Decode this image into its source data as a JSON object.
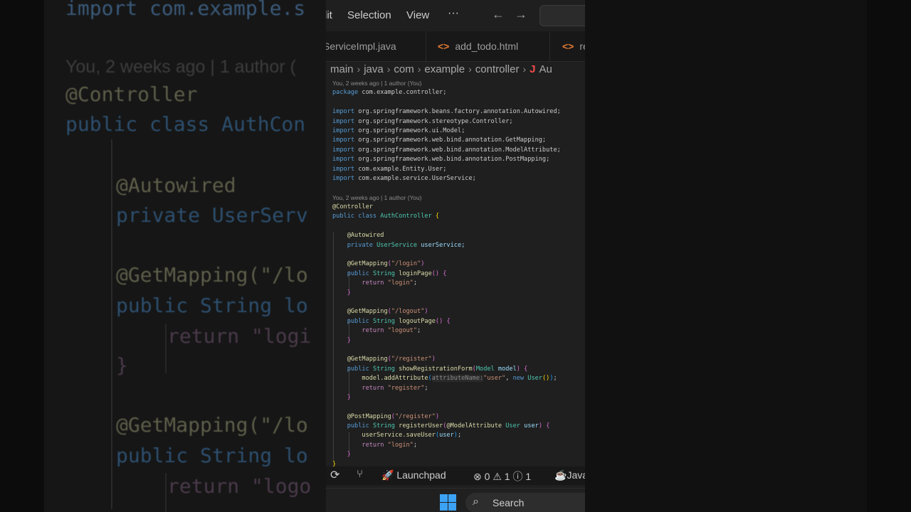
{
  "menubar": {
    "items": [
      "lit",
      "Selection",
      "View",
      "···"
    ]
  },
  "tabs": [
    {
      "label": "ServiceImpl.java",
      "icon": "java-file-icon"
    },
    {
      "label": "add_todo.html",
      "icon": "html-file-icon",
      "glyph": "<>"
    },
    {
      "label": "re",
      "icon": "html-file-icon",
      "glyph": "<>"
    }
  ],
  "breadcrumb": {
    "parts": [
      "main",
      "java",
      "com",
      "example",
      "controller"
    ],
    "file_glyph": "J",
    "file": "Au",
    "separator": "›"
  },
  "codelens": {
    "top": "You, 2 weeks ago | 1 author (You)",
    "class": "You, 2 weeks ago | 1 author (You)"
  },
  "code": {
    "package_kw": "package",
    "package_name": "com.example.controller;",
    "import_kw": "import",
    "imports": [
      "org.springframework.beans.factory.annotation.Autowired;",
      "org.springframework.stereotype.Controller;",
      "org.springframework.ui.Model;",
      "org.springframework.web.bind.annotation.GetMapping;",
      "org.springframework.web.bind.annotation.ModelAttribute;",
      "org.springframework.web.bind.annotation.PostMapping;",
      "com.example.Entity.User;",
      "com.example.service.UserService;"
    ],
    "class_annotation": "@Controller",
    "public_kw": "public",
    "class_kw": "class",
    "class_name": "AuthController",
    "open_brace": "{",
    "close_brace": "}",
    "field_annotation": "@Autowired",
    "private_kw": "private",
    "field_type": "UserService",
    "field_name": "userService;",
    "get_mapping": "@GetMapping",
    "post_mapping": "@PostMapping",
    "string_type": "String",
    "return_kw": "return",
    "new_kw": "new",
    "login_path": "\"/login\"",
    "login_method": "loginPage",
    "login_return": "\"login\"",
    "logout_path": "\"/logout\"",
    "logout_method": "logoutPage",
    "logout_return": "\"logout\"",
    "register_path": "\"/register\"",
    "show_method": "showRegistrationForm",
    "model_type": "Model",
    "model_var": "model",
    "add_attr": "model.addAttribute",
    "hint": "attributeName:",
    "user_str": "\"user\"",
    "user_type": "User",
    "register_return": "\"register\"",
    "register_method": "registerUser",
    "model_attr_ann": "@ModelAttribute",
    "user_var": "user",
    "save_call": "userService.saveUser",
    "login_return2": "\"login\""
  },
  "statusbar": {
    "launchpad": "Launchpad",
    "errors": "0",
    "warnings": "1",
    "infos": "1",
    "language": "Java"
  },
  "taskbar": {
    "search_label": "Search"
  },
  "background": {
    "lines": [
      "import com.example.s",
      "You, 2 weeks ago | 1 author (",
      "@Controller",
      "public class AuthCon",
      "@Autowired",
      "private UserServ",
      "@GetMapping(\"/lo",
      "public String lo",
      "return \"logi",
      "}",
      "@GetMapping(\"/lo",
      "public String lo",
      "return \"logo"
    ]
  }
}
